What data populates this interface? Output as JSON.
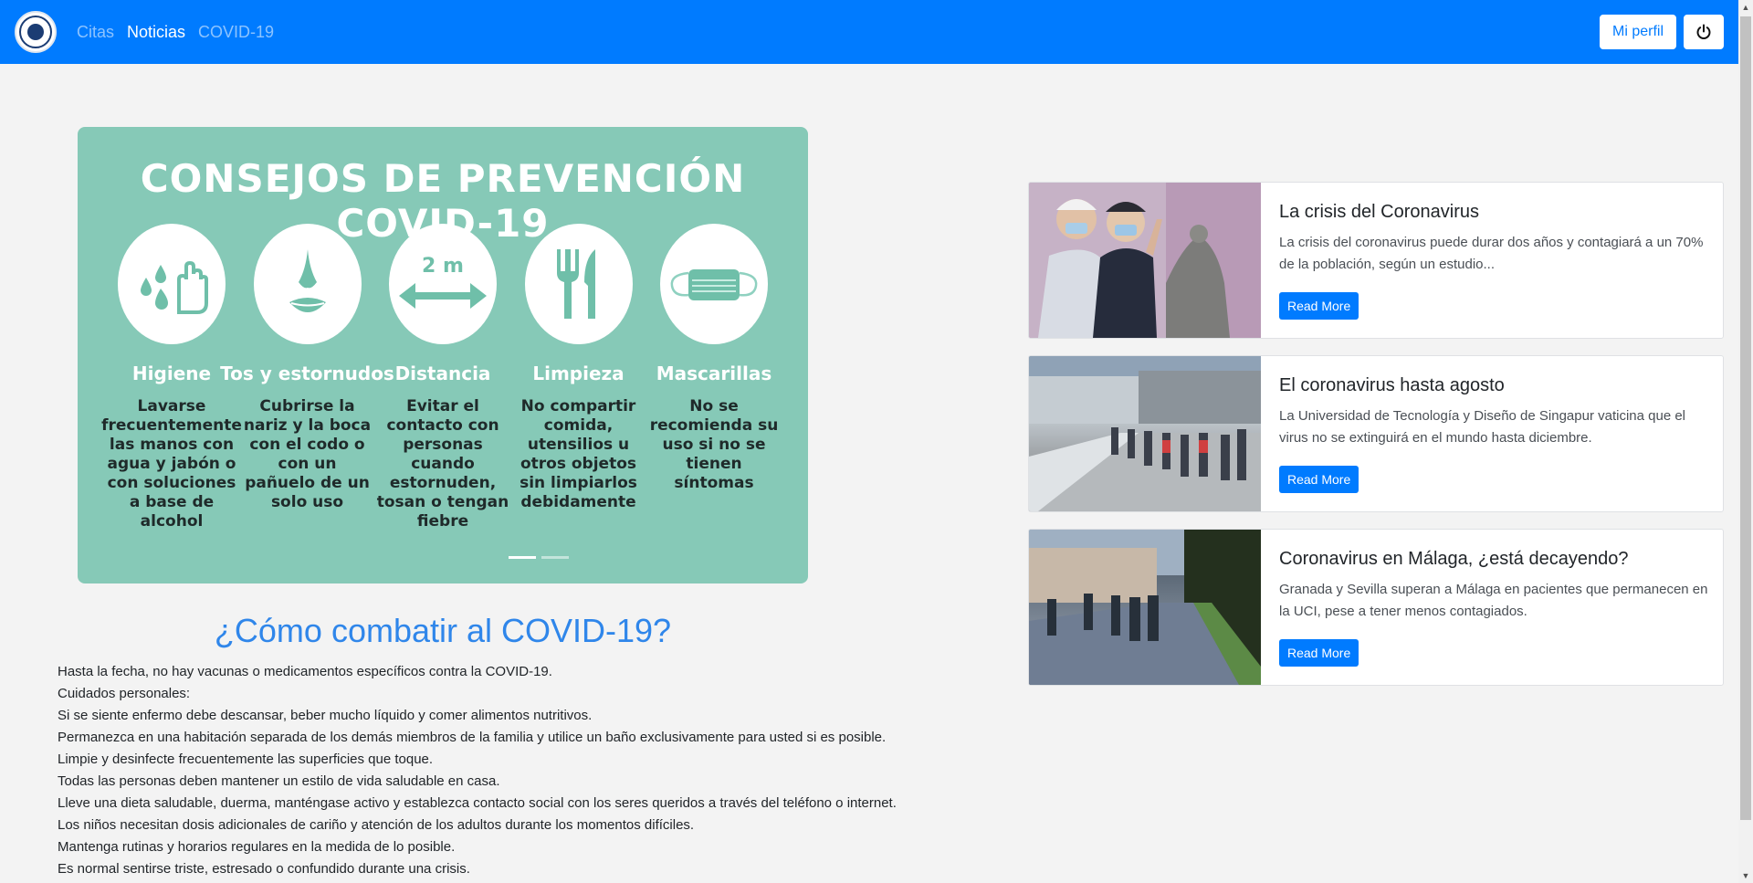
{
  "nav": {
    "links": [
      "Citas",
      "Noticias",
      "COVID-19"
    ],
    "active": "Noticias",
    "profile_label": "Mi perfil",
    "power_icon": "power-icon"
  },
  "carousel": {
    "title": "CONSEJOS DE PREVENCIÓN COVID-19",
    "tips": [
      {
        "icon": "hands-water-icon",
        "name": "Higiene",
        "desc": "Lavarse frecuentemente las manos con agua y jabón o con soluciones a base de alcohol"
      },
      {
        "icon": "nose-mouth-icon",
        "name": "Tos y estornudos",
        "desc": "Cubrirse la nariz y la boca con el codo o con un pañuelo de un solo uso"
      },
      {
        "icon": "distance-icon",
        "name": "Distancia",
        "icon_text": "2 m",
        "desc": "Evitar el contacto con personas cuando estornuden, tosan o tengan fiebre"
      },
      {
        "icon": "cutlery-icon",
        "name": "Limpieza",
        "desc": "No compartir comida, utensilios u otros objetos sin limpiarlos debidamente"
      },
      {
        "icon": "mask-icon",
        "name": "Mascarillas",
        "desc": "No se recomienda su uso si no se tienen síntomas"
      }
    ],
    "active_slide": 1,
    "slide_count": 2
  },
  "article": {
    "heading": "¿Cómo combatir al COVID-19?",
    "lines": [
      "Hasta la fecha, no hay vacunas o medicamentos específicos contra la COVID-19.",
      "Cuidados personales:",
      "Si se siente enfermo debe descansar, beber mucho líquido y comer alimentos nutritivos.",
      "Permanezca en una habitación separada de los demás miembros de la familia y utilice un baño exclusivamente para usted si es posible.",
      "Limpie y desinfecte frecuentemente las superficies que toque.",
      "Todas las personas deben mantener un estilo de vida saludable en casa.",
      "Lleve una dieta saludable, duerma, manténgase activo y establezca contacto social con los seres queridos a través del teléfono o internet.",
      "Los niños necesitan dosis adicionales de cariño y atención de los adultos durante los momentos difíciles.",
      "Mantenga rutinas y horarios regulares en la medida de lo posible.",
      "Es normal sentirse triste, estresado o confundido durante una crisis."
    ]
  },
  "news": [
    {
      "title": "La crisis del Coronavirus",
      "text": "La crisis del coronavirus puede durar dos años y contagiará a un 70% de la población, según un estudio...",
      "button": "Read More"
    },
    {
      "title": "El coronavirus hasta agosto",
      "text": "La Universidad de Tecnología y Diseño de Singapur vaticina que el virus no se extinguirá en el mundo hasta diciembre.",
      "button": "Read More"
    },
    {
      "title": "Coronavirus en Málaga, ¿está decayendo?",
      "text": "Granada y Sevilla superan a Málaga en pacientes que permanecen en la UCI, pese a tener menos contagiados.",
      "button": "Read More"
    }
  ]
}
